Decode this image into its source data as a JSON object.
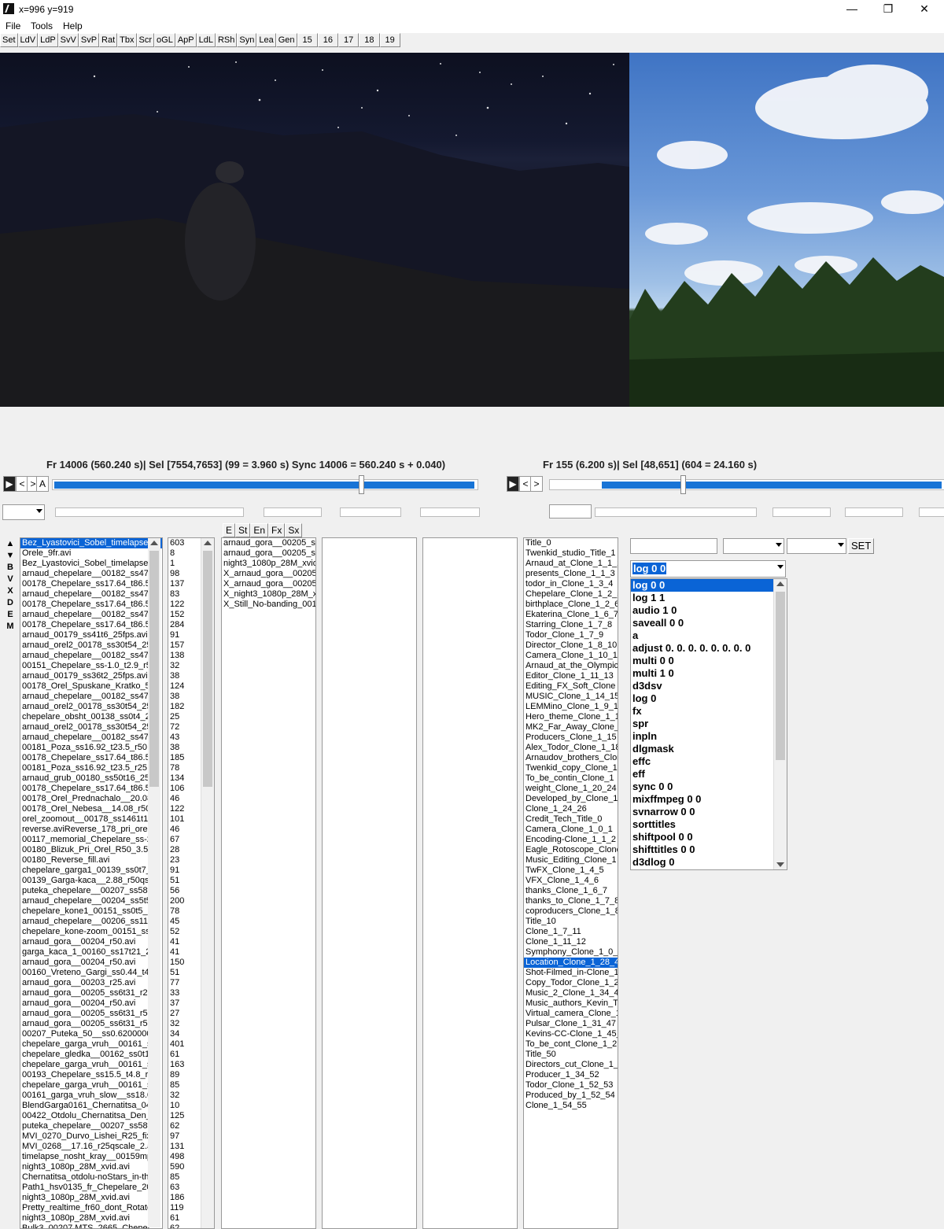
{
  "window": {
    "title": "x=996 y=919",
    "minimize": "—",
    "maximize": "❐",
    "close": "✕"
  },
  "menu": [
    "File",
    "Tools",
    "Help"
  ],
  "toolbar": [
    "Set",
    "LdV",
    "LdP",
    "SvV",
    "SvP",
    "Rat",
    "Tbx",
    "Scr",
    "oGL",
    "ApP",
    "LdL",
    "RSh",
    "Syn",
    "Lea",
    "Gen",
    "15",
    "16",
    "17",
    "18",
    "19"
  ],
  "status": {
    "left": "Fr 14006 (560.240 s)| Sel [7554,7653] (99 = 3.960 s) Sync 14006 = 560.240 s +  0.040)",
    "right": "Fr 155 (6.200 s)| Sel [48,651] (604 = 24.160 s)"
  },
  "progress": {
    "left_fill": 0.72,
    "right_fill": 0.33
  },
  "nav_left": [
    "▶",
    "<",
    ">",
    "A"
  ],
  "nav_right": [
    "▶",
    "<",
    ">"
  ],
  "edit_buttons": [
    "E",
    "St",
    "En",
    "Fx",
    "Sx"
  ],
  "side_buttons": [
    "▲",
    "▼",
    "B",
    "V",
    "X",
    "D",
    "E",
    "M"
  ],
  "files": [
    "Bez_Lyastovici_Sobel_timelapse",
    "Orele_9fr.avi",
    "Bez_Lyastovici_Sobel_timelapse_",
    "arnaud_chepelare__00182_ss47t4",
    "00178_Chepelare_ss17.64_t86.5_",
    "arnaud_chepelare__00182_ss47t4",
    "00178_Chepelare_ss17.64_t86.5_",
    "arnaud_chepelare__00182_ss47t4",
    "00178_Chepelare_ss17.64_t86.5_",
    "arnaud_00179_ss41t6_25fps.avi",
    "arnaud_orel2_00178_ss30t54_25",
    "arnaud_chepelare__00182_ss47t4",
    "00151_Chepelare_ss-1.0_t2.9_r5(",
    "arnaud_00179_ss36t2_25fps.avi",
    "00178_Orel_Spuskane_Kratko_5",
    "arnaud_chepelare__00182_ss47t4",
    "arnaud_orel2_00178_ss30t54_25",
    "chepelare_obsht_00138_ss0t4_2",
    "arnaud_orel2_00178_ss30t54_25",
    "arnaud_chepelare__00182_ss47t4",
    "00181_Poza_ss16.92_t23.5_r50.a",
    "00178_Chepelare_ss17.64_t86.5_",
    "00181_Poza_ss16.92_t23.5_r25.a",
    "arnaud_grub_00180_ss50t16_25f",
    "00178_Chepelare_ss17.64_t86.5_",
    "00178_Orel_Prednachalo__20.08",
    "00178_Orel_Nebesa__14.08_r50(",
    "orel_zoomout__00178_ss1461t10_",
    "reverse.aviReverse_178_pri_orelr",
    "00117_memorial_Chepelare_ss-2.",
    "00180_Blizuk_Pri_Orel_R50_3.5_",
    "00180_Reverse_fill.avi",
    "chepelare_garga1_00139_ss0t7_",
    "00139_Garga-kaca__2.88_r50qsc",
    "puteka_chepelare__00207_ss58t3",
    "arnaud_chepelare__00204_ss5t5_",
    "chepelare_kone1_00151_ss0t5_2",
    "arnaud_chepelare__00206_ss11t1",
    "chepelare_kone-zoom_00151_ss5",
    "arnaud_gora__00204_r50.avi",
    "garga_kaca_1_00160_ss17t21_2",
    "arnaud_gora__00204_r50.avi",
    "00160_Vreteno_Gargi_ss0.44_t4.",
    "arnaud_gora__00203_r25.avi",
    "arnaud_gora__00205_ss6t31_r25.a",
    "arnaud_gora__00204_r50.avi",
    "arnaud_gora__00205_ss6t31_r50.a",
    "arnaud_gora__00205_ss6t31_r50.a",
    "00207_Puteka_50__ss0.6200000",
    "chepelare_garga_vruh__00161_ss",
    "chepelare_gledka__00162_ss0t14.",
    "chepelare_garga_vruh__00161_ss",
    "00193_Chepelare_ss15.5_t4.8_r5",
    "chepelare_garga_vruh__00161_ss",
    "00161_garga_vruh_slow__ss18.0",
    "BlendGarga0161_Chernatitsa_04.",
    "00422_Otdolu_Chernatitsa_Den_",
    "puteka_chepelare__00207_ss58t3",
    "MVI_0270_Durvo_Lishei_R25_fix",
    "MVI_0268__17.16_r25qscale_2.a",
    "timelapse_nosht_kray__00159mp4.",
    "night3_1080p_28M_xvid.avi",
    "Chernatitsa_otdolu-noStars_in-the",
    "Path1_hsv0135_fr_Chepelare_20",
    "night3_1080p_28M_xvid.avi",
    "Pretty_realtime_fr60_dont_Rotate",
    "night3_1080p_28M_xvid.avi",
    "Bulk3_00207.MTS_2665_Chepel"
  ],
  "counts": [
    "603",
    "8",
    "1",
    "98",
    "137",
    "83",
    "122",
    "152",
    "284",
    "91",
    "157",
    "138",
    "32",
    "38",
    "124",
    "38",
    "182",
    "25",
    "72",
    "43",
    "38",
    "185",
    "78",
    "134",
    "106",
    "46",
    "122",
    "101",
    "46",
    "67",
    "28",
    "23",
    "91",
    "51",
    "56",
    "200",
    "78",
    "45",
    "52",
    "41",
    "41",
    "150",
    "51",
    "77",
    "33",
    "37",
    "27",
    "32",
    "34",
    "401",
    "61",
    "163",
    "89",
    "85",
    "32",
    "10",
    "125",
    "62",
    "97",
    "131",
    "498",
    "590",
    "85",
    "63",
    "186",
    "119",
    "61",
    "62"
  ],
  "clips": [
    "arnaud_gora__00205_ss6",
    "arnaud_gora__00205_ss6",
    "night3_1080p_28M_xvid",
    "X_arnaud_gora__00205_s",
    "X_arnaud_gora__00205_s",
    "X_night3_1080p_28M_x",
    "X_Still_No-banding_001"
  ],
  "titles": [
    "Title_0",
    "Twenkid_studio_Title_1",
    "Arnaud_at_Clone_1_1_2",
    "presents_Clone_1_1_3",
    "todor_in_Clone_1_3_4",
    "Chepelare_Clone_1_2_5",
    "birthplace_Clone_1_2_6",
    "Ekaterina_Clone_1_6_7",
    "Starring_Clone_1_7_8",
    "Todor_Clone_1_7_9",
    "Director_Clone_1_8_10",
    "Camera_Clone_1_10_11",
    "Arnaud_at_the_Olympic",
    "Editor_Clone_1_11_13",
    "Editing_FX_Soft_Clone",
    "MUSIC_Clone_1_14_15",
    "LEMMino_Clone_1_9_16",
    "Hero_theme_Clone_1_1",
    "MK2_Far_Away_Clone_",
    "Producers_Clone_1_15",
    "Alex_Todor_Clone_1_18",
    "Arnaudov_brothers_Clon",
    "Twenkid_copy_Clone_1",
    "To_be_contin_Clone_1",
    "weight_Clone_1_20_24",
    "Developed_by_Clone_1",
    "Clone_1_24_26",
    "Credit_Tech_Title_0",
    "Camera_Clone_1_0_1",
    "Encoding-Clone_1_1_2",
    "Eagle_Rotoscope_Clone",
    "Music_Editing_Clone_1",
    "TwFX_Clone_1_4_5",
    "VFX_Clone_1_4_6",
    "thanks_Clone_1_6_7",
    "thanks_to_Clone_1_7_8",
    "coproducers_Clone_1_8",
    "Title_10",
    "Clone_1_7_11",
    "Clone_1_11_12",
    "Symphony_Clone_1_0_1",
    "Location_Clone_1_28_4",
    "Shot-Filmed_in-Clone_1",
    "Copy_Todor_Clone_1_2",
    "Music_2_Clone_1_34_4",
    "Music_authors_Kevin_T",
    "Virtual_camera_Clone_1",
    "Pulsar_Clone_1_31_47",
    "Kevins-CC-Clone_1_45_",
    "To_be_cont_Clone_1_2",
    "Title_50",
    "Directors_cut_Clone_1_4",
    "Producer_1_34_52",
    "Todor_Clone_1_52_53",
    "Produced_by_1_52_54",
    "Clone_1_54_55"
  ],
  "titles_selected_index": 41,
  "files_selected_index": 0,
  "set_button": "SET",
  "command_combo_value": "log 0 0",
  "commands": [
    "log 0 0",
    "log 1 1",
    "audio 1 0",
    "saveall 0 0",
    "a",
    "adjust 0. 0. 0. 0. 0. 0. 0. 0",
    "multi 0 0",
    "multi 1 0",
    "d3dsv",
    "log 0",
    "fx",
    "spr",
    "inpln",
    "dlgmask",
    "effc",
    "eff",
    "sync 0 0",
    "mixffmpeg 0 0",
    "svnarrow 0 0",
    "sorttitles",
    "shiftpool 0 0",
    "shifttitles 0 0",
    "d3dlog 0"
  ],
  "commands_selected_index": 0
}
